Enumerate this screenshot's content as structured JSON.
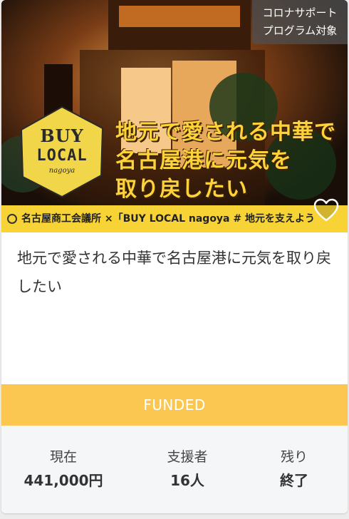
{
  "card": {
    "corner_badge": [
      "コロナサポート",
      "プログラム対象"
    ],
    "hero": {
      "logo": [
        "BUY",
        "LOCAL",
        "nagoya"
      ],
      "slogan": [
        "地元で愛される中華で",
        "名古屋港に元気を",
        "取り戻したい"
      ],
      "strip_text": "名古屋商工会議所 ×「BUY LOCAL nagoya # 地元を支えよう",
      "heart_icon": "heart-outline-icon"
    },
    "title": "地元で愛される中華で名古屋港に元気を取り戻したい",
    "status": "FUNDED",
    "stats": [
      {
        "label": "現在",
        "value": "441,000円"
      },
      {
        "label": "支援者",
        "value": "16人"
      },
      {
        "label": "残り",
        "value": "終了"
      }
    ]
  },
  "colors": {
    "funded_bg": "#fbc750",
    "strip_bg": "#f7d335",
    "slogan": "#ffd23a",
    "stats_bg": "#f5f6f8"
  }
}
